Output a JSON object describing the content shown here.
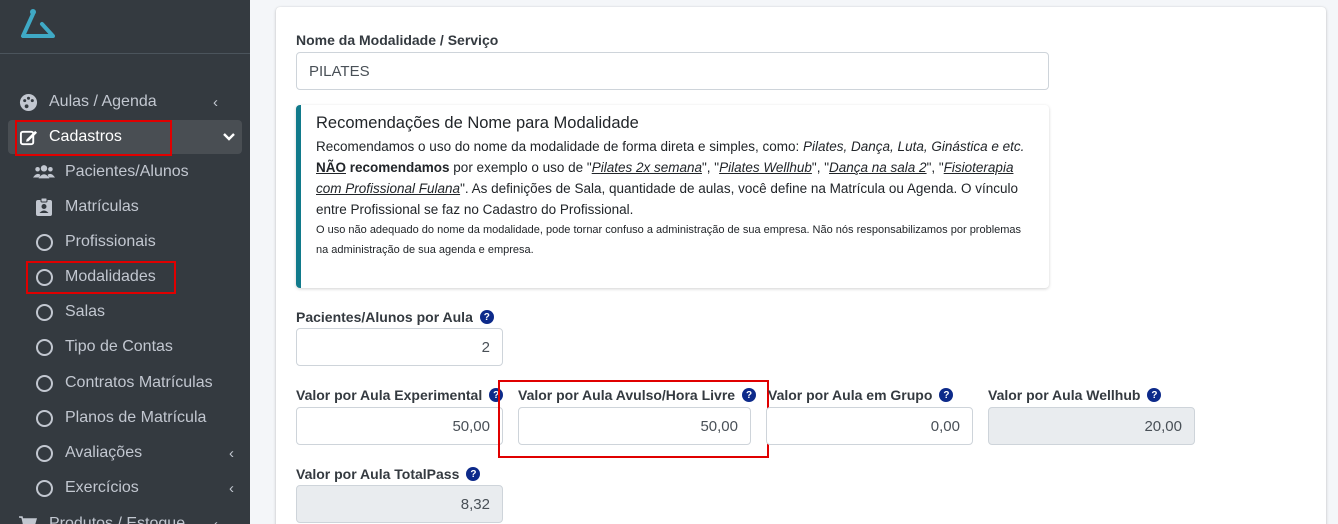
{
  "colors": {
    "sidebar_bg": "#343a40",
    "accent": "#3fa9c5",
    "highlight_box": "#e00000",
    "callout_border": "#117a8b",
    "help_icon": "#0d2a8a"
  },
  "sidebar": {
    "logo_icon": "hanger-logo-icon",
    "menu": [
      {
        "label": "Aulas / Agenda",
        "icon": "palette-icon",
        "chevron": "‹"
      },
      {
        "label": "Cadastros",
        "icon": "edit-icon",
        "chevron": "⌄"
      }
    ],
    "submenu": [
      {
        "label": "Pacientes/Alunos",
        "icon": "users-icon"
      },
      {
        "label": "Matrículas",
        "icon": "id-badge-icon"
      },
      {
        "label": "Profissionais",
        "icon": "circle-icon"
      },
      {
        "label": "Modalidades",
        "icon": "circle-icon"
      },
      {
        "label": "Salas",
        "icon": "circle-icon"
      },
      {
        "label": "Tipo de Contas",
        "icon": "circle-icon"
      },
      {
        "label": "Contratos Matrículas",
        "icon": "circle-icon"
      },
      {
        "label": "Planos de Matrícula",
        "icon": "circle-icon"
      },
      {
        "label": "Avaliações",
        "icon": "circle-icon",
        "chevron": "‹"
      },
      {
        "label": "Exercícios",
        "icon": "circle-icon",
        "chevron": "‹"
      }
    ],
    "bottom_item": {
      "label": "Produtos / Estoque",
      "icon": "cart-icon",
      "chevron": "‹"
    }
  },
  "form": {
    "name_label": "Nome da Modalidade / Serviço",
    "name_value": "PILATES",
    "callout": {
      "title": "Recomendações de Nome para Modalidade",
      "p1_text": "Recomendamos o uso do nome da modalidade de forma direta e simples, como: ",
      "p1_examples": "Pilates, Dança, Luta, Ginástica e etc.",
      "p2_nao": "NÃO",
      "p2_bold": " recomendamos",
      "p2_text1": " por exemplo o uso de \"",
      "ex1": "Pilates 2x semana",
      "sep1": "\", \"",
      "ex2": "Pilates Wellhub",
      "sep2": "\", \"",
      "ex3": "Dança na sala 2",
      "sep3": "\", \"",
      "ex4": "Fisioterapia com Profissional Fulana",
      "p2_text2": "\". As definições de Sala, quantidade de aulas, você define na Matrícula ou Agenda. O vínculo entre Profissional se faz no Cadastro do Profissional.",
      "small": "O uso não adequado do nome da modalidade, pode tornar confuso a administração de sua empresa. Não nós responsabilizamos por problemas na administração de sua agenda e empresa."
    },
    "per_class_label": "Pacientes/Alunos por Aula",
    "per_class_value": "2",
    "help_glyph": "?",
    "prices": [
      {
        "label": "Valor por Aula Experimental",
        "value": "50,00"
      },
      {
        "label": "Valor por Aula Avulso/Hora Livre",
        "value": "50,00"
      },
      {
        "label": "Valor por Aula em Grupo",
        "value": "0,00"
      },
      {
        "label": "Valor por Aula Wellhub",
        "value": "20,00"
      }
    ],
    "totalpass_label": "Valor por Aula TotalPass",
    "totalpass_value": "8,32"
  }
}
